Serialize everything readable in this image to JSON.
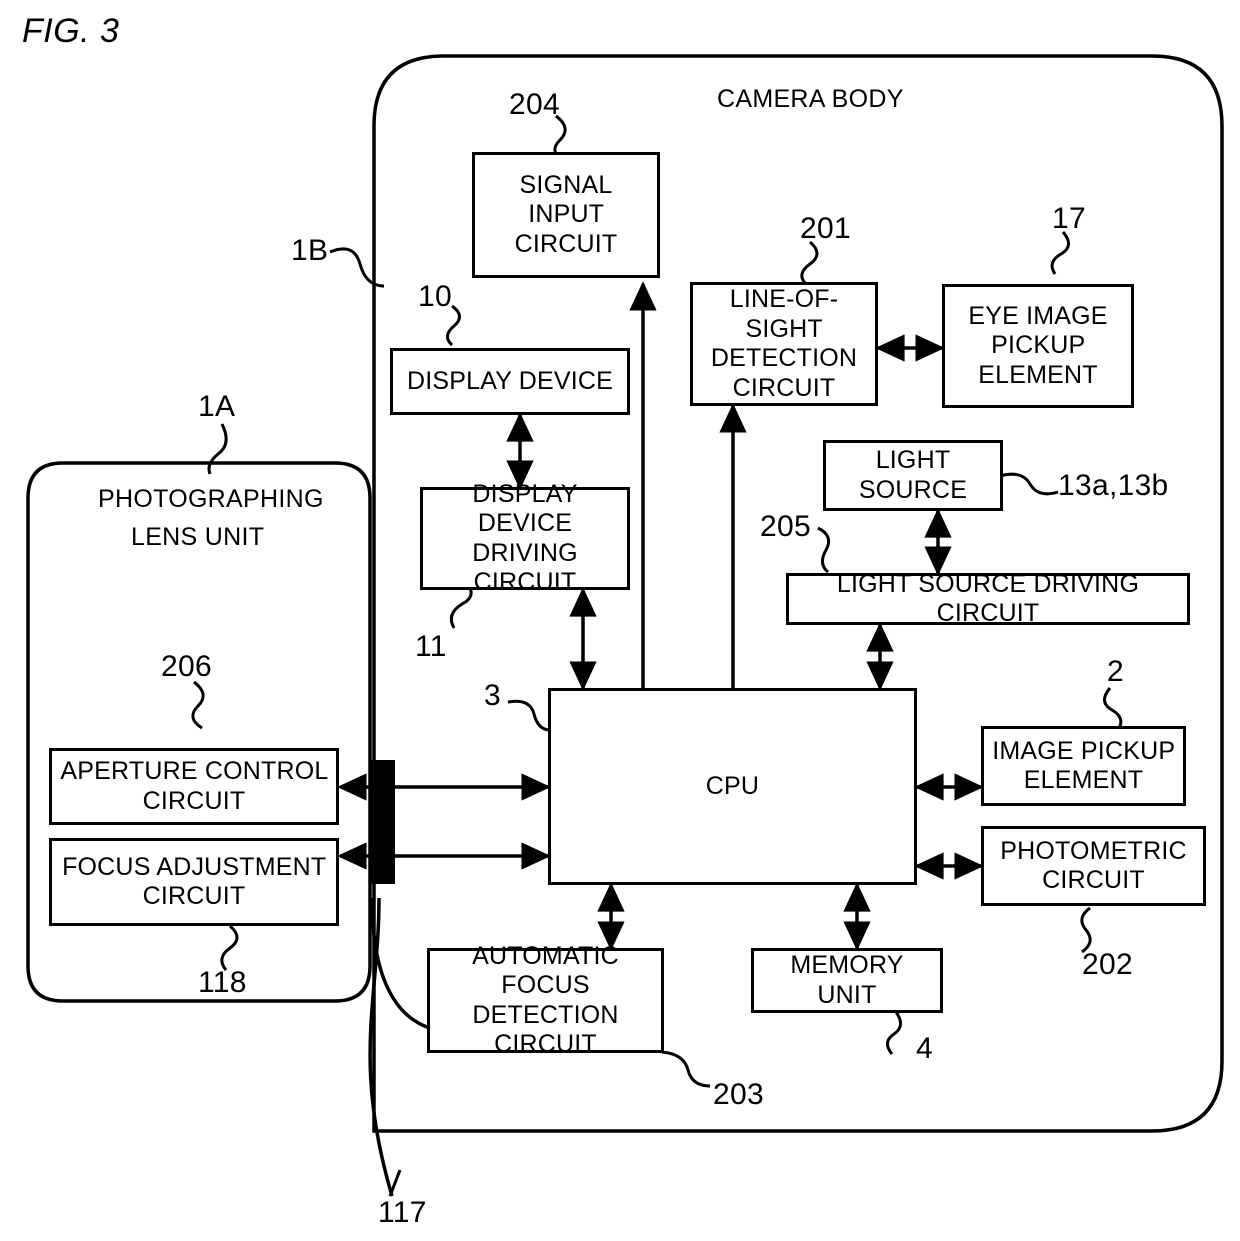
{
  "figure": {
    "number_label": "FIG. 3",
    "camera_body_label": "CAMERA BODY",
    "lens_unit_label_line1": "PHOTOGRAPHING",
    "lens_unit_label_line2": "LENS UNIT"
  },
  "blocks": {
    "signal_input_circuit": {
      "line1": "SIGNAL INPUT",
      "line2": "CIRCUIT"
    },
    "display_device": {
      "line1": "DISPLAY DEVICE"
    },
    "display_device_driving_circuit": {
      "line1": "DISPLAY DEVICE",
      "line2": "DRIVING CIRCUIT"
    },
    "line_of_sight_detection_circuit": {
      "line1": "LINE-OF-SIGHT",
      "line2": "DETECTION",
      "line3": "CIRCUIT"
    },
    "eye_image_pickup_element": {
      "line1": "EYE IMAGE",
      "line2": "PICKUP",
      "line3": "ELEMENT"
    },
    "light_source": {
      "line1": "LIGHT SOURCE"
    },
    "light_source_driving_circuit": {
      "line1": "LIGHT SOURCE DRIVING CIRCUIT"
    },
    "cpu": {
      "line1": "CPU"
    },
    "image_pickup_element": {
      "line1": "IMAGE PICKUP",
      "line2": "ELEMENT"
    },
    "photometric_circuit": {
      "line1": "PHOTOMETRIC",
      "line2": "CIRCUIT"
    },
    "automatic_focus_detection_circuit": {
      "line1": "AUTOMATIC FOCUS",
      "line2": "DETECTION",
      "line3": "CIRCUIT"
    },
    "memory_unit": {
      "line1": "MEMORY UNIT"
    },
    "aperture_control_circuit": {
      "line1": "APERTURE CONTROL",
      "line2": "CIRCUIT"
    },
    "focus_adjustment_circuit": {
      "line1": "FOCUS ADJUSTMENT",
      "line2": "CIRCUIT"
    }
  },
  "reference_numerals": {
    "camera_body": "1B",
    "lens_unit": "1A",
    "signal_input_circuit": "204",
    "display_device": "10",
    "display_device_driving_circuit": "11",
    "line_of_sight_detection_circuit": "201",
    "eye_image_pickup_element": "17",
    "light_source": "13a,13b",
    "light_source_driving_circuit": "205",
    "cpu": "3",
    "image_pickup_element": "2",
    "photometric_circuit": "202",
    "automatic_focus_detection_circuit": "203",
    "memory_unit": "4",
    "aperture_control_circuit": "206",
    "focus_adjustment_circuit": "118",
    "mount_contact": "117"
  }
}
